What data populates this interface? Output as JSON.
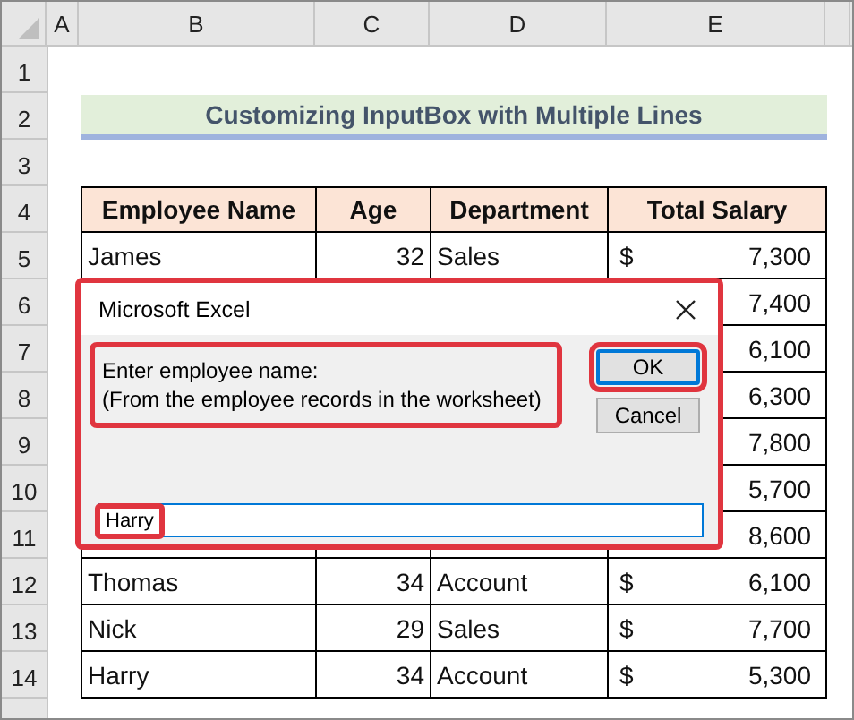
{
  "column_headers": [
    "A",
    "B",
    "C",
    "D",
    "E"
  ],
  "row_headers": [
    "1",
    "2",
    "3",
    "4",
    "5",
    "6",
    "7",
    "8",
    "9",
    "10",
    "11",
    "12",
    "13",
    "14"
  ],
  "title": "Customizing InputBox with Multiple Lines",
  "table": {
    "columns": [
      "Employee Name",
      "Age",
      "Department",
      "Total Salary"
    ],
    "rows": [
      {
        "name": "James",
        "age": "32",
        "department": "Sales",
        "currency": "$",
        "amount": "7,300"
      },
      {
        "amount": "7,400"
      },
      {
        "amount": "6,100"
      },
      {
        "amount": "6,300"
      },
      {
        "amount": "7,800"
      },
      {
        "amount": "5,700"
      },
      {
        "amount": "8,600"
      },
      {
        "name": "Thomas",
        "age": "34",
        "department": "Account",
        "currency": "$",
        "amount": "6,100"
      },
      {
        "name": "Nick",
        "age": "29",
        "department": "Sales",
        "currency": "$",
        "amount": "7,700"
      },
      {
        "name": "Harry",
        "age": "34",
        "department": "Account",
        "currency": "$",
        "amount": "5,300"
      }
    ]
  },
  "dialog": {
    "title": "Microsoft Excel",
    "highlighted": true,
    "prompt": {
      "text": "Enter employee name:\n(From the employee records in the worksheet)",
      "highlighted": true
    },
    "buttons": [
      {
        "label": "OK",
        "default": true,
        "highlighted": true
      },
      {
        "label": "Cancel",
        "default": false,
        "highlighted": false
      }
    ],
    "input": {
      "value": "Harry",
      "highlighted": true
    }
  }
}
